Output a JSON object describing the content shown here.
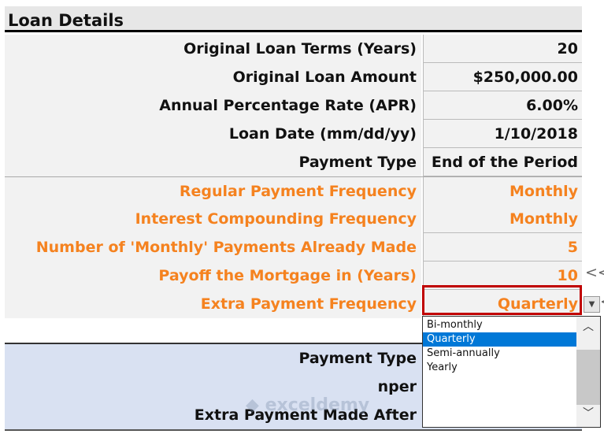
{
  "header": {
    "title": "Loan Details"
  },
  "rows": [
    {
      "label": "Original Loan Terms (Years)",
      "value": "20"
    },
    {
      "label": "Original Loan Amount",
      "value": "$250,000.00"
    },
    {
      "label": "Annual Percentage Rate (APR)",
      "value": "6.00%"
    },
    {
      "label": "Loan Date (mm/dd/yy)",
      "value": "1/10/2018"
    },
    {
      "label": "Payment Type",
      "value": "End of the Period"
    },
    {
      "label": "Regular Payment Frequency",
      "value": "Monthly"
    },
    {
      "label": "Interest Compounding Frequency",
      "value": "Monthly"
    },
    {
      "label": "Number of 'Monthly' Payments Already Made",
      "value": "5"
    },
    {
      "label": "Payoff the Mortgage in (Years)",
      "value": "10"
    },
    {
      "label": "Extra Payment Frequency",
      "value": "Quarterly"
    }
  ],
  "side_marks": {
    "payoff": "<<",
    "extra": "<"
  },
  "lower_rows": [
    {
      "label": "Payment Type"
    },
    {
      "label": "nper"
    },
    {
      "label": "Extra Payment Made After"
    }
  ],
  "dropdown": {
    "options": [
      "Bi-monthly",
      "Quarterly",
      "Semi-annually",
      "Yearly"
    ],
    "selected": "Quarterly"
  },
  "watermark": "exceldemy",
  "colors": {
    "orange": "#f5821f",
    "selection": "#0078d7",
    "active_border": "#c00000",
    "lower_bg": "#d9e1f2"
  }
}
